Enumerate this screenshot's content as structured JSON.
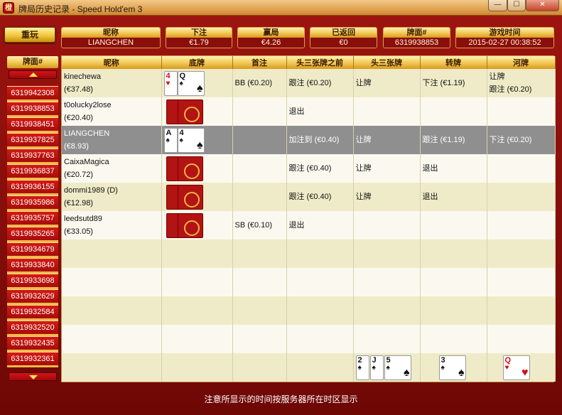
{
  "window": {
    "title": "牌局历史记录 - Speed Hold'em 3",
    "icon": "app-logo-icon",
    "min_glyph": "—",
    "max_glyph": "☐",
    "close_glyph": "✕"
  },
  "replay_label": "重玩",
  "info": {
    "nickname": {
      "label": "昵称",
      "value": "LIANGCHEN"
    },
    "bet": {
      "label": "下注",
      "value": "€1.79"
    },
    "won": {
      "label": "赢局",
      "value": "€4.26"
    },
    "returned": {
      "label": "已返回",
      "value": "€0"
    },
    "hand_no": {
      "label": "牌面#",
      "value": "6319938853"
    },
    "game_time": {
      "label": "游戏时间",
      "value": "2015-02-27 00:38:52"
    }
  },
  "sidebar": {
    "header": "牌面#",
    "items": [
      "6319942308",
      "6319938853",
      "6319938451",
      "6319937825",
      "6319937763",
      "6319936837",
      "6319936155",
      "6319935986",
      "6319935757",
      "6319935265",
      "6319934679",
      "6319933840",
      "6319933698",
      "6319932629",
      "6319932584",
      "6319932520",
      "6319932435",
      "6319932361"
    ]
  },
  "columns": [
    "昵称",
    "底牌",
    "首注",
    "头三张牌之前",
    "头三张牌",
    "转牌",
    "河牌"
  ],
  "rows": [
    {
      "name": "kinechewa",
      "stack": "(€37.48)",
      "cards": [
        {
          "r": "4",
          "s": "♥",
          "c": "red"
        },
        {
          "r": "Q",
          "s": "♠",
          "c": "black"
        }
      ],
      "first_bet": "BB (€0.20)",
      "preflop": "跟注 (€0.20)",
      "flop": "让牌",
      "turn": "下注 (€1.19)",
      "river1": "让牌",
      "river2": "跟注 (€0.20)"
    },
    {
      "name": "t0olucky2lose",
      "stack": "(€20.40)",
      "cards": [],
      "first_bet": "",
      "preflop": "退出",
      "flop": "",
      "turn": "",
      "river1": "",
      "river2": ""
    },
    {
      "name": "LIANGCHEN",
      "stack": "(€8.93)",
      "cards": [
        {
          "r": "A",
          "s": "♠",
          "c": "black"
        },
        {
          "r": "4",
          "s": "♠",
          "c": "black"
        }
      ],
      "first_bet": "",
      "preflop": "加注到 (€0.40)",
      "flop": "让牌",
      "turn": "跟注 (€1.19)",
      "river1": "下注 (€0.20)",
      "river2": ""
    },
    {
      "name": "CaixaMagica",
      "stack": "(€20.72)",
      "cards": [],
      "first_bet": "",
      "preflop": "跟注 (€0.40)",
      "flop": "让牌",
      "turn": "退出",
      "river1": "",
      "river2": ""
    },
    {
      "name": "dommi1989 (D)",
      "stack": "(€12.98)",
      "cards": [],
      "first_bet": "",
      "preflop": "跟注 (€0.40)",
      "flop": "让牌",
      "turn": "退出",
      "river1": "",
      "river2": ""
    },
    {
      "name": "leedsutd89",
      "stack": "(€33.05)",
      "cards": [],
      "first_bet": "SB (€0.10)",
      "preflop": "退出",
      "flop": "",
      "turn": "",
      "river1": "",
      "river2": ""
    }
  ],
  "board": {
    "flop": [
      {
        "r": "2",
        "s": "♠",
        "c": "black"
      },
      {
        "r": "J",
        "s": "♠",
        "c": "black"
      },
      {
        "r": "5",
        "s": "♠",
        "c": "black"
      }
    ],
    "turn": [
      {
        "r": "3",
        "s": "♠",
        "c": "black"
      }
    ],
    "river": [
      {
        "r": "Q",
        "s": "♥",
        "c": "red"
      }
    ]
  },
  "footer_note": "注意所显示的时间按服务器所在时区显示"
}
